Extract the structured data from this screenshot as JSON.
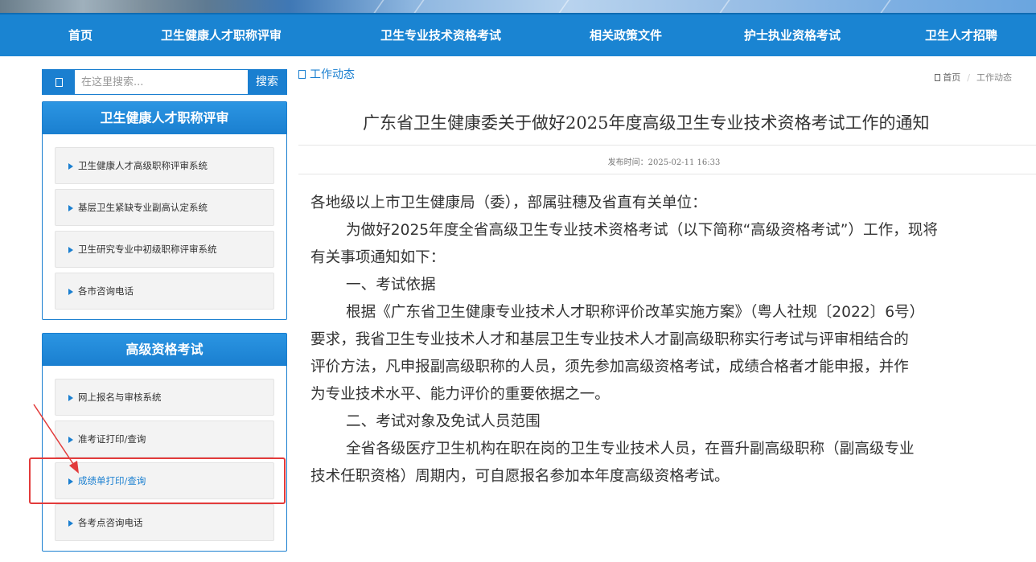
{
  "nav": {
    "items": [
      "首页",
      "卫生健康人才职称评审",
      "卫生专业技术资格考试",
      "相关政策文件",
      "护士执业资格考试",
      "卫生人才招聘"
    ]
  },
  "search": {
    "placeholder": "在这里搜索...",
    "button": "搜索"
  },
  "panels": [
    {
      "title": "卫生健康人才职称评审",
      "items": [
        "卫生健康人才高级职称评审系统",
        "基层卫生紧缺专业副高认定系统",
        "卫生研究专业中初级职称评审系统",
        "各市咨询电话"
      ]
    },
    {
      "title": "高级资格考试",
      "items": [
        "网上报名与审核系统",
        "准考证打印/查询",
        "成绩单打印/查询",
        "各考点咨询电话"
      ]
    }
  ],
  "breadcrumb": {
    "section": "工作动态",
    "home": "首页",
    "current": "工作动态"
  },
  "article": {
    "title": "广东省卫生健康委关于做好2025年度高级卫生专业技术资格考试工作的通知",
    "pubtime": "发布时间：2025-02-11 16:33",
    "lines": [
      "各地级以上市卫生健康局（委），部属驻穗及省直有关单位：",
      "为做好2025年度全省高级卫生专业技术资格考试（以下简称“高级资格考试”）工作，现将",
      "有关事项通知如下：",
      "一、考试依据",
      "根据《广东省卫生健康专业技术人才职称评价改革实施方案》（粤人社规〔2022〕6号）",
      "要求，我省卫生专业技术人才和基层卫生专业技术人才副高级职称实行考试与评审相结合的",
      "评价方法，凡申报副高级职称的人员，须先参加高级资格考试，成绩合格者才能申报，并作",
      "为专业技术水平、能力评价的重要依据之一。",
      "二、考试对象及免试人员范围",
      "全省各级医疗卫生机构在职在岗的卫生专业技术人员，在晋升副高级职称（副高级专业",
      "技术任职资格）周期内，可自愿报名参加本年度高级资格考试。"
    ]
  },
  "colors": {
    "primary": "#1a84d2",
    "highlight": "#e23b3b"
  }
}
